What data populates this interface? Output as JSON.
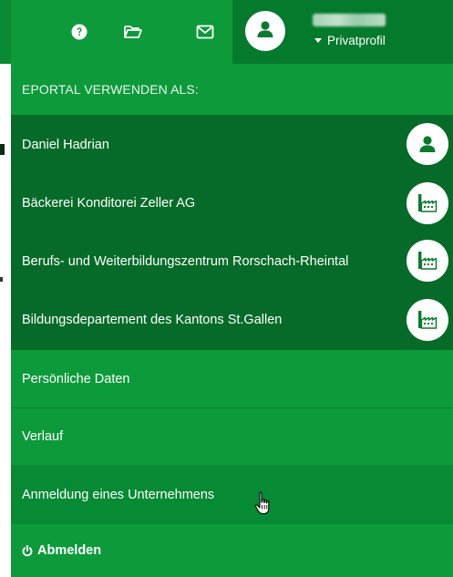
{
  "header": {
    "help_icon": "question-circle-icon",
    "folder_icon": "folder-open-icon",
    "mail_icon": "envelope-icon",
    "profile": {
      "avatar_icon": "user-icon",
      "role_label": "Privatprofil"
    }
  },
  "menu": {
    "section_title": "EPORTAL VERWENDEN ALS:",
    "profiles": [
      {
        "label": "Daniel Hadrian",
        "icon": "user-icon"
      },
      {
        "label": "Bäckerei Konditorei Zeller AG",
        "icon": "factory-icon"
      },
      {
        "label": "Berufs- und Weiterbildungszentrum Rorschach-Rheintal",
        "icon": "factory-icon"
      },
      {
        "label": "Bildungsdepartement des Kantons St.Gallen",
        "icon": "factory-icon"
      }
    ],
    "items": [
      {
        "label": "Persönliche Daten"
      },
      {
        "label": "Verlauf"
      },
      {
        "label": "Anmeldung eines Unternehmens"
      }
    ],
    "logout": {
      "label": "Abmelden",
      "icon": "power-icon"
    }
  },
  "colors": {
    "brand_green": "#0c9a3a",
    "dark_green": "#066b28",
    "profile_bg": "#047a2c"
  }
}
